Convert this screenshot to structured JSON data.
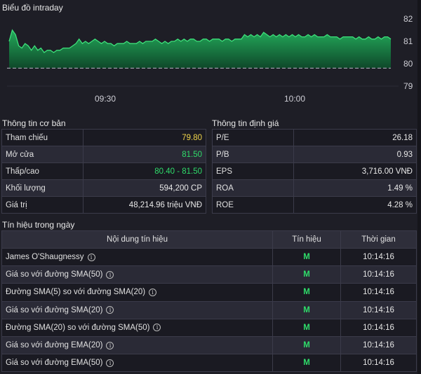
{
  "chart": {
    "title": "Biểu đồ intraday",
    "y_ticks": [
      "82",
      "81",
      "80",
      "79"
    ],
    "x_ticks": [
      "09:30",
      "10:00"
    ],
    "colors": {
      "line": "#3de07a",
      "fill_top": "#23b15d",
      "fill_bottom": "#0e4a2a",
      "ref_line": "#9a9aa8"
    }
  },
  "chart_data": {
    "type": "area",
    "title": "Biểu đồ intraday",
    "x_ticks": [
      "09:30",
      "10:00"
    ],
    "ylim": [
      79,
      82
    ],
    "reference": 79.8,
    "values": [
      81.0,
      81.5,
      81.3,
      80.8,
      80.7,
      80.9,
      80.8,
      80.6,
      80.8,
      80.6,
      80.7,
      80.5,
      80.6,
      80.6,
      80.5,
      80.6,
      80.6,
      80.7,
      80.7,
      80.7,
      80.8,
      80.9,
      81.1,
      80.9,
      81.0,
      80.9,
      81.0,
      81.1,
      81.0,
      80.9,
      81.0,
      80.9,
      80.9,
      80.8,
      80.9,
      80.9,
      80.9,
      81.0,
      80.9,
      80.9,
      80.9,
      81.0,
      80.9,
      81.0,
      81.0,
      81.0,
      81.1,
      81.0,
      80.9,
      81.0,
      80.9,
      81.0,
      81.0,
      81.1,
      81.0,
      81.1,
      81.0,
      81.1,
      81.1,
      81.0,
      81.0,
      81.1,
      81.1,
      81.0,
      81.1,
      81.1,
      81.1,
      81.0,
      81.1,
      81.1,
      81.0,
      81.1,
      81.1,
      81.1,
      81.3,
      81.2,
      81.3,
      81.2,
      81.3,
      81.2,
      81.4,
      81.3,
      81.2,
      81.3,
      81.2,
      81.3,
      81.2,
      81.3,
      81.2,
      81.3,
      81.2,
      81.3,
      81.2,
      81.2,
      81.3,
      81.2,
      81.3,
      81.2,
      81.2,
      81.2,
      81.3,
      81.2,
      81.2,
      81.2,
      81.1,
      81.2,
      81.2,
      81.2,
      81.2,
      81.1,
      81.2,
      81.1,
      81.1,
      81.2,
      81.1,
      81.1,
      81.2,
      81.1,
      81.2,
      81.2,
      81.1
    ]
  },
  "basic": {
    "title": "Thông tin cơ bản",
    "rows": [
      {
        "label": "Tham chiếu",
        "value": "79.80",
        "color": "yellow"
      },
      {
        "label": "Mở cửa",
        "value": "81.50",
        "color": "green"
      },
      {
        "label": "Thấp/cao",
        "value": "80.40 - 81.50",
        "color": "green"
      },
      {
        "label": "Khối lượng",
        "value": "594,200 CP",
        "color": ""
      },
      {
        "label": "Giá trị",
        "value": "48,214.96 triệu VNĐ",
        "color": ""
      }
    ]
  },
  "valuation": {
    "title": "Thông tin định giá",
    "rows": [
      {
        "label": "P/E",
        "value": "26.18"
      },
      {
        "label": "P/B",
        "value": "0.93"
      },
      {
        "label": "EPS",
        "value": "3,716.00 VNĐ"
      },
      {
        "label": "ROA",
        "value": "1.49 %"
      },
      {
        "label": "ROE",
        "value": "4.28 %"
      }
    ]
  },
  "signals": {
    "title": "Tín hiệu trong ngày",
    "headers": [
      "Nội dung tín hiệu",
      "Tín hiệu",
      "Thời gian"
    ],
    "rows": [
      {
        "content": "James O'Shaugnessy",
        "signal": "M",
        "time": "10:14:16"
      },
      {
        "content": "Giá so với đường SMA(50)",
        "signal": "M",
        "time": "10:14:16"
      },
      {
        "content": "Đường SMA(5) so với đường SMA(20)",
        "signal": "M",
        "time": "10:14:16"
      },
      {
        "content": "Giá so với đường SMA(20)",
        "signal": "M",
        "time": "10:14:16"
      },
      {
        "content": "Đường SMA(20) so với đường SMA(50)",
        "signal": "M",
        "time": "10:14:16"
      },
      {
        "content": "Giá so với đường EMA(20)",
        "signal": "M",
        "time": "10:14:16"
      },
      {
        "content": "Giá so với đường EMA(50)",
        "signal": "M",
        "time": "10:14:16"
      }
    ]
  }
}
